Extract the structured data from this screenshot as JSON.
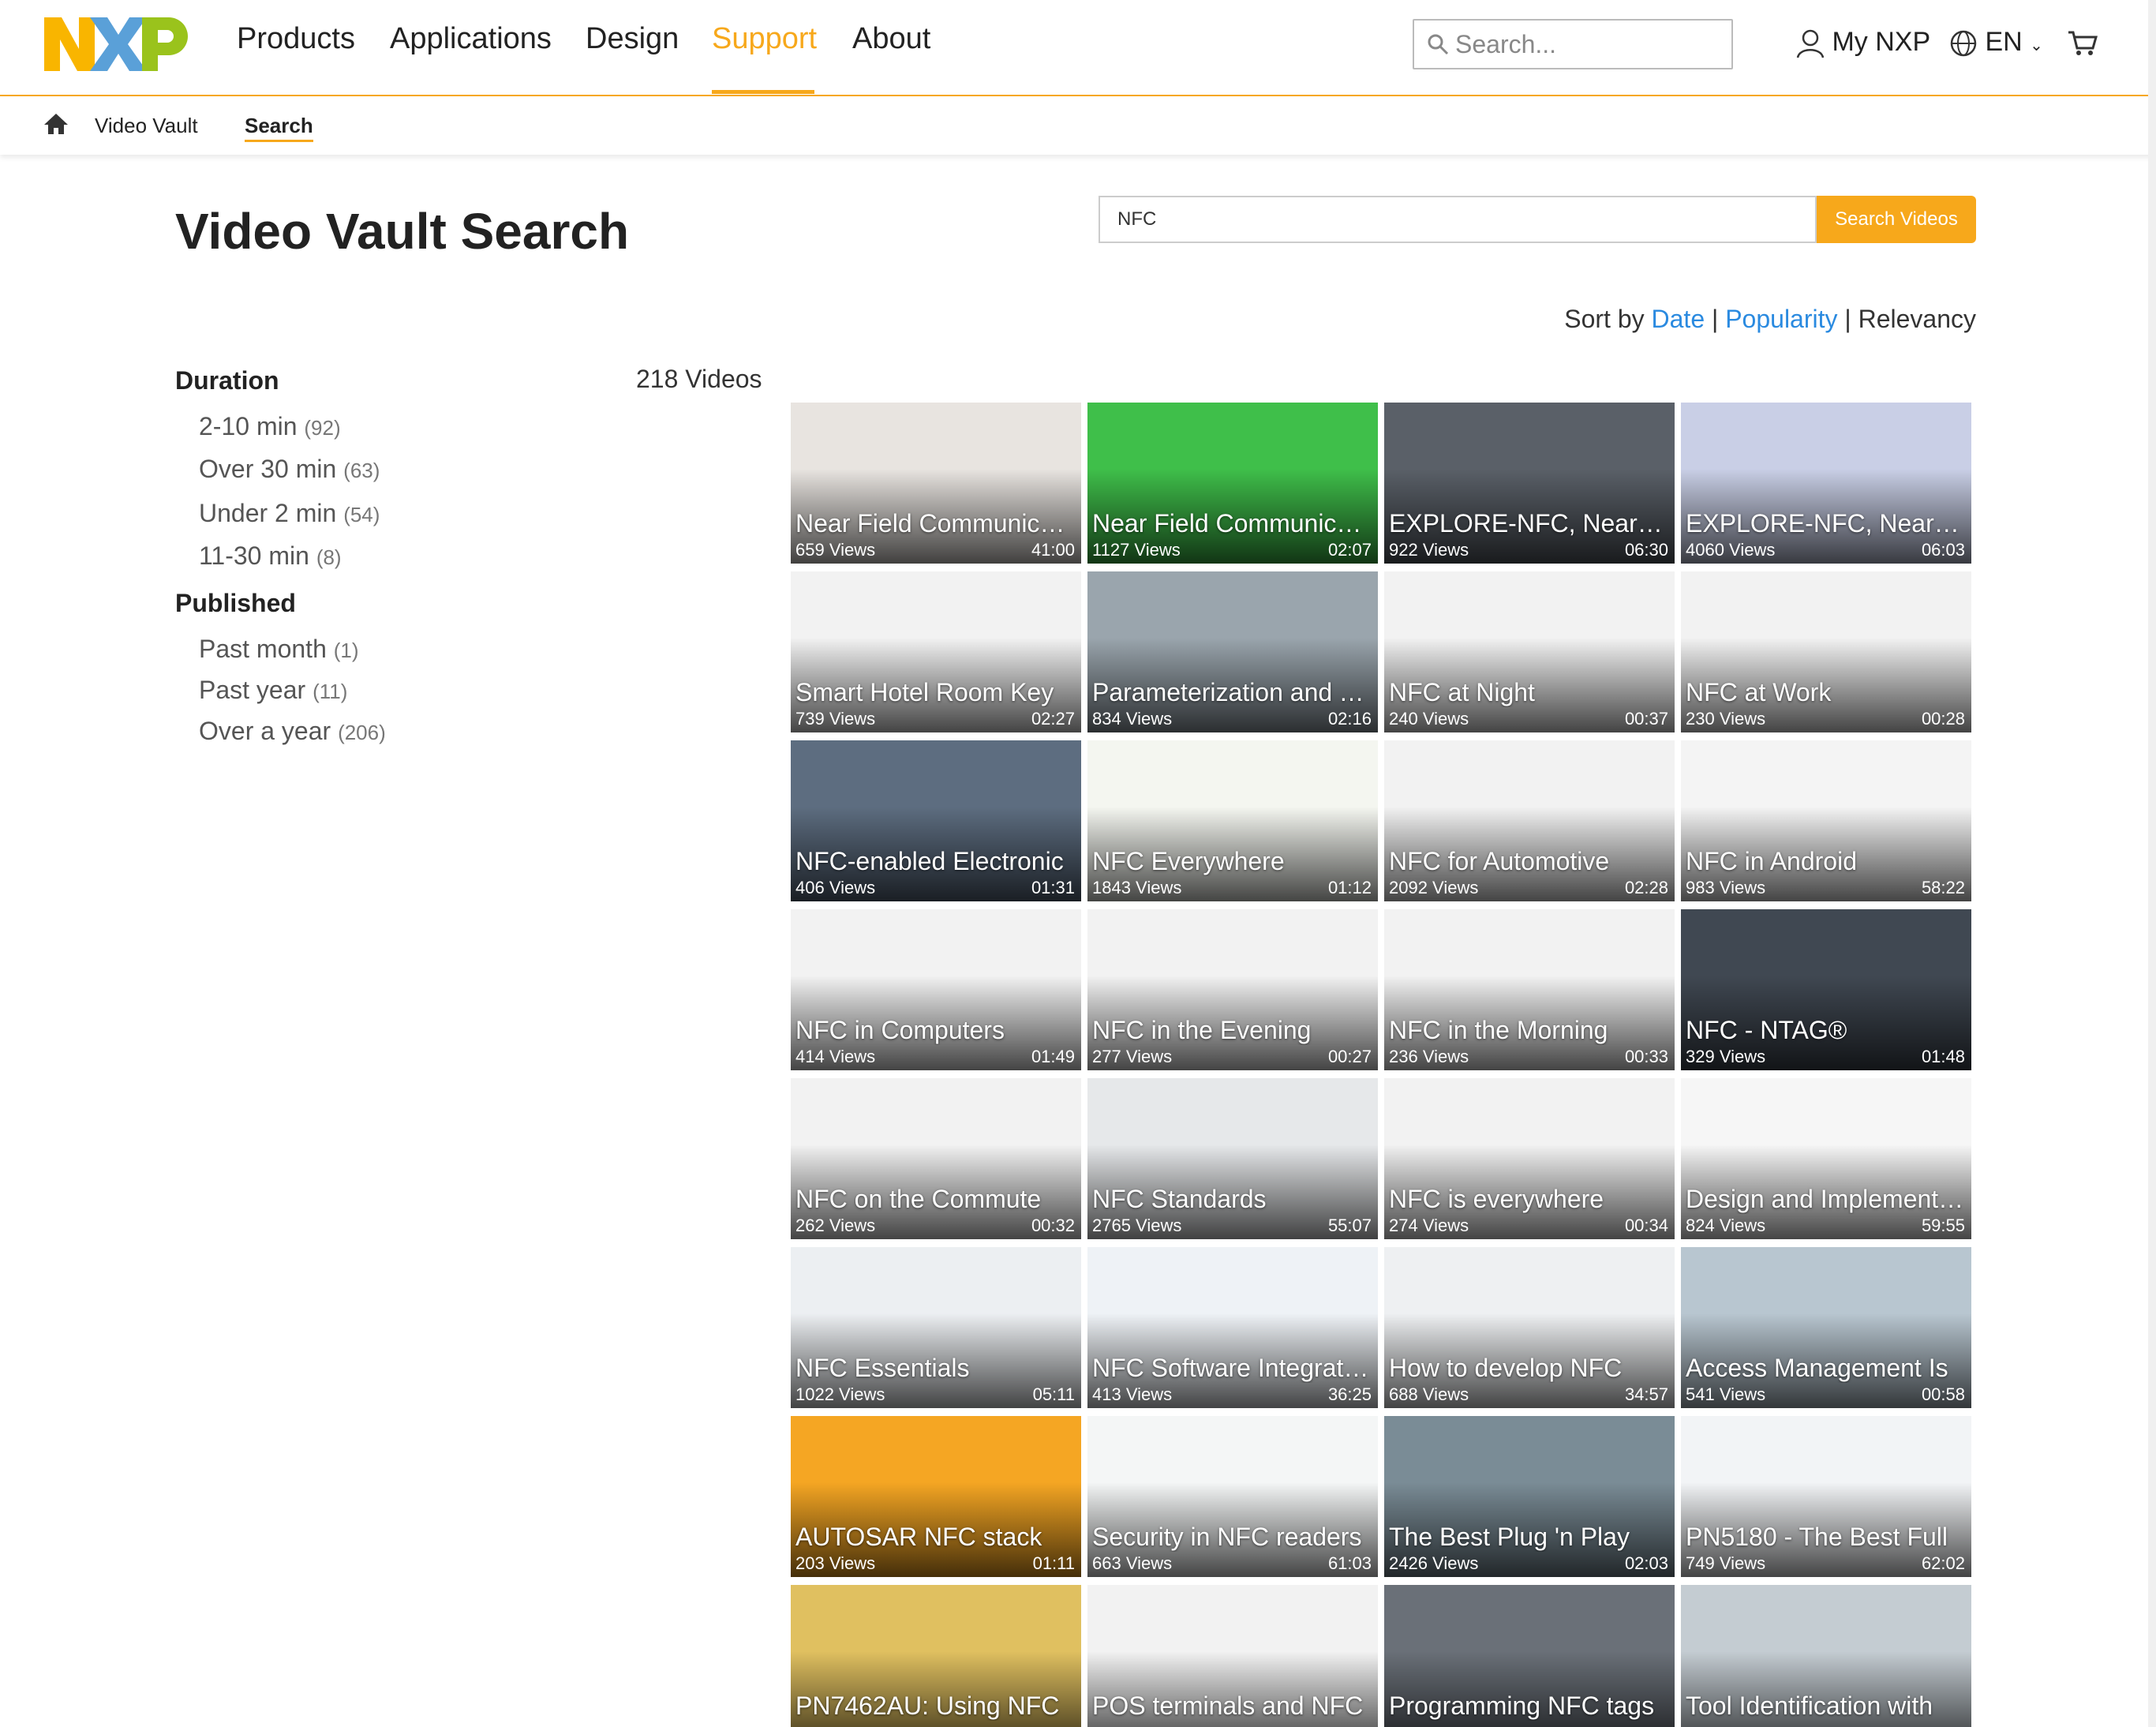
{
  "header": {
    "logo_text": "NXP",
    "nav": [
      "Products",
      "Applications",
      "Design",
      "Support",
      "About"
    ],
    "active_nav": "Support",
    "search_placeholder": "Search...",
    "my_nxp": "My NXP",
    "language": "EN"
  },
  "breadcrumb": {
    "items": [
      "Video Vault",
      "Search"
    ]
  },
  "page": {
    "title": "Video Vault Search",
    "search_value": "NFC",
    "search_button": "Search Videos",
    "sort": {
      "label": "Sort by",
      "date": "Date",
      "popularity": "Popularity",
      "relevancy": "Relevancy",
      "sep": "|"
    },
    "result_count": "218 Videos"
  },
  "facets": {
    "duration": {
      "heading": "Duration",
      "items": [
        {
          "label": "2-10 min",
          "count": "(92)"
        },
        {
          "label": "Over 30 min",
          "count": "(63)"
        },
        {
          "label": "Under 2 min",
          "count": "(54)"
        },
        {
          "label": "11-30 min",
          "count": "(8)"
        }
      ]
    },
    "published": {
      "heading": "Published",
      "items": [
        {
          "label": "Past month",
          "count": "(1)"
        },
        {
          "label": "Past year",
          "count": "(11)"
        },
        {
          "label": "Over a year",
          "count": "(206)"
        }
      ]
    }
  },
  "colors": {
    "accent": "#f7a81b",
    "link": "#2a8ae0"
  },
  "videos": [
    {
      "title": "Near Field Communication",
      "views": "659 Views",
      "duration": "41:00",
      "bg": "#e8e4e0"
    },
    {
      "title": "Near Field Communication",
      "views": "1127 Views",
      "duration": "02:07",
      "bg": "#3fbf4a"
    },
    {
      "title": "EXPLORE-NFC, Near Field",
      "views": "922 Views",
      "duration": "06:30",
      "bg": "#5a6068"
    },
    {
      "title": "EXPLORE-NFC, Near Field",
      "views": "4060 Views",
      "duration": "06:03",
      "bg": "#c9cfe6"
    },
    {
      "title": "Smart Hotel Room Key",
      "views": "739 Views",
      "duration": "02:27",
      "bg": "#f2f2f2"
    },
    {
      "title": "Parameterization and Test",
      "views": "834 Views",
      "duration": "02:16",
      "bg": "#9aa5ad"
    },
    {
      "title": "NFC at Night",
      "views": "240 Views",
      "duration": "00:37",
      "bg": "#f2f2f2"
    },
    {
      "title": "NFC at Work",
      "views": "230 Views",
      "duration": "00:28",
      "bg": "#f2f2f2"
    },
    {
      "title": "NFC-enabled Electronic",
      "views": "406 Views",
      "duration": "01:31",
      "bg": "#5d6d80"
    },
    {
      "title": "NFC Everywhere",
      "views": "1843 Views",
      "duration": "01:12",
      "bg": "#f4f6f0"
    },
    {
      "title": "NFC for Automotive",
      "views": "2092 Views",
      "duration": "02:28",
      "bg": "#f2f2f2"
    },
    {
      "title": "NFC in Android",
      "views": "983 Views",
      "duration": "58:22",
      "bg": "#f4f4f4"
    },
    {
      "title": "NFC in Computers",
      "views": "414 Views",
      "duration": "01:49",
      "bg": "#f2f2f2"
    },
    {
      "title": "NFC in the Evening",
      "views": "277 Views",
      "duration": "00:27",
      "bg": "#f2f2f2"
    },
    {
      "title": "NFC in the Morning",
      "views": "236 Views",
      "duration": "00:33",
      "bg": "#f2f2f2"
    },
    {
      "title": "NFC - NTAG®",
      "views": "329 Views",
      "duration": "01:48",
      "bg": "#404852"
    },
    {
      "title": "NFC on the Commute",
      "views": "262 Views",
      "duration": "00:32",
      "bg": "#f2f2f2"
    },
    {
      "title": "NFC Standards",
      "views": "2765 Views",
      "duration": "55:07",
      "bg": "#e6e8ea"
    },
    {
      "title": "NFC is everywhere",
      "views": "274 Views",
      "duration": "00:34",
      "bg": "#f2f2f2"
    },
    {
      "title": "Design and Implementation",
      "views": "824 Views",
      "duration": "59:55",
      "bg": "#f6f6f6"
    },
    {
      "title": "NFC Essentials",
      "views": "1022 Views",
      "duration": "05:11",
      "bg": "#eceff2"
    },
    {
      "title": "NFC Software Integration",
      "views": "413 Views",
      "duration": "36:25",
      "bg": "#eef2f6"
    },
    {
      "title": "How to develop NFC",
      "views": "688 Views",
      "duration": "34:57",
      "bg": "#eef0f2"
    },
    {
      "title": "Access Management Is",
      "views": "541 Views",
      "duration": "00:58",
      "bg": "#b8c6d0"
    },
    {
      "title": "AUTOSAR NFC stack",
      "views": "203 Views",
      "duration": "01:11",
      "bg": "#f5a623"
    },
    {
      "title": "Security in NFC readers",
      "views": "663 Views",
      "duration": "61:03",
      "bg": "#f4f6f6"
    },
    {
      "title": "The Best Plug 'n Play",
      "views": "2426 Views",
      "duration": "02:03",
      "bg": "#7a8c96"
    },
    {
      "title": "PN5180 - The Best Full",
      "views": "749 Views",
      "duration": "62:02",
      "bg": "#f2f4f6"
    },
    {
      "title": "PN7462AU: Using NFC",
      "views": "",
      "duration": "",
      "bg": "#e0c060"
    },
    {
      "title": "POS terminals and NFC",
      "views": "",
      "duration": "",
      "bg": "#f2f2f2"
    },
    {
      "title": "Programming NFC tags",
      "views": "",
      "duration": "",
      "bg": "#6a7078"
    },
    {
      "title": "Tool Identification with",
      "views": "",
      "duration": "",
      "bg": "#c4ccd2"
    }
  ]
}
